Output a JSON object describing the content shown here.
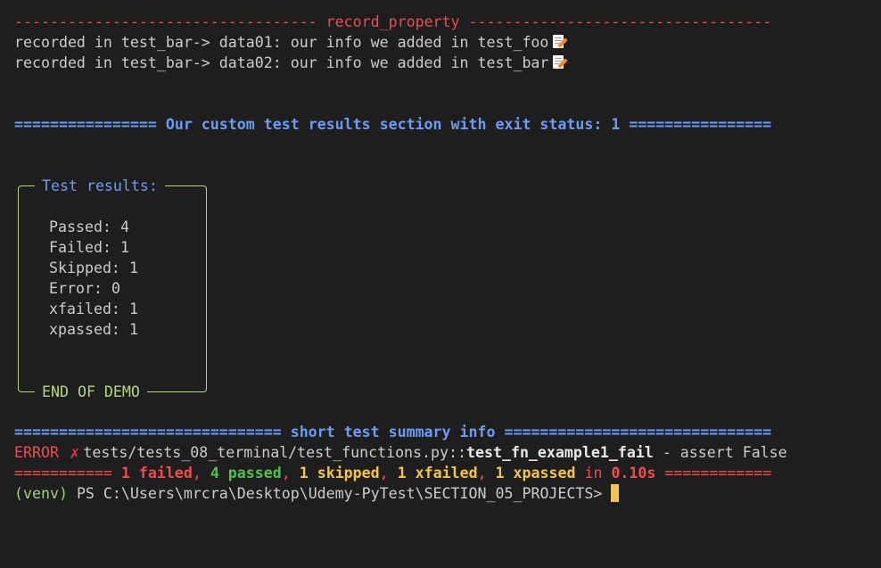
{
  "record_property": {
    "header_left": "---------------------------------- ",
    "header_title": "record_property",
    "header_right": " ----------------------------------",
    "lines": [
      "recorded in test_bar-> data01: our info we added in test_foo",
      "recorded in test_bar-> data02: our info we added in test_bar"
    ],
    "icon": "memo-icon"
  },
  "custom_section": {
    "rule_left": "================ ",
    "title": "Our custom test results section with exit status: 1",
    "rule_right": " ================"
  },
  "results_box": {
    "title": "Test results:",
    "items": [
      {
        "label": "Passed:",
        "value": "4"
      },
      {
        "label": "Failed:",
        "value": "1"
      },
      {
        "label": "Skipped:",
        "value": "1"
      },
      {
        "label": "Error:",
        "value": "0"
      },
      {
        "label": "xfailed:",
        "value": "1"
      },
      {
        "label": "xpassed:",
        "value": "1"
      }
    ],
    "footer": "END OF DEMO"
  },
  "short_summary": {
    "rule_left": "============================== ",
    "title": "short test summary info",
    "rule_right": " =============================="
  },
  "error_line": {
    "label": "ERROR",
    "icon": "cross-mark-icon",
    "path": "tests/tests_08_terminal/test_functions.py::",
    "test_name": "test_fn_example1_fail",
    "message": " - assert False"
  },
  "final_summary": {
    "rule_left": "=========== ",
    "failed": "1 failed",
    "sep1": ", ",
    "passed": "4 passed",
    "sep2": ", ",
    "skipped": "1 skipped",
    "sep3": ", ",
    "xfailed": "1 xfailed",
    "sep4": ", ",
    "xpassed": "1 xpassed",
    "in_text": " in ",
    "duration": "0.10s",
    "rule_right": " ============"
  },
  "prompt": {
    "venv": "(venv)",
    "path": " PS C:\\Users\\mrcra\\Desktop\\Udemy-PyTest\\SECTION_05_PROJECTS>"
  },
  "colors": {
    "background": "#1e1e1e",
    "red": "#f14c4c",
    "blue": "#6b9bf5",
    "green": "#4ec24e",
    "yellow": "#f5c542",
    "box_border": "#b5d67a"
  }
}
